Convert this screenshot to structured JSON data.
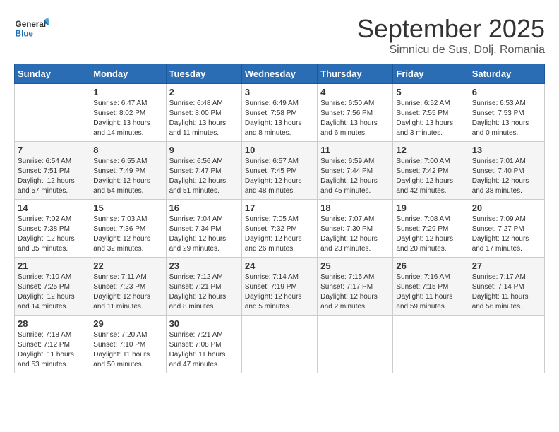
{
  "logo": {
    "general": "General",
    "blue": "Blue"
  },
  "header": {
    "month_title": "September 2025",
    "subtitle": "Simnicu de Sus, Dolj, Romania"
  },
  "days_of_week": [
    "Sunday",
    "Monday",
    "Tuesday",
    "Wednesday",
    "Thursday",
    "Friday",
    "Saturday"
  ],
  "weeks": [
    [
      {
        "day": "",
        "info": ""
      },
      {
        "day": "1",
        "info": "Sunrise: 6:47 AM\nSunset: 8:02 PM\nDaylight: 13 hours and 14 minutes."
      },
      {
        "day": "2",
        "info": "Sunrise: 6:48 AM\nSunset: 8:00 PM\nDaylight: 13 hours and 11 minutes."
      },
      {
        "day": "3",
        "info": "Sunrise: 6:49 AM\nSunset: 7:58 PM\nDaylight: 13 hours and 8 minutes."
      },
      {
        "day": "4",
        "info": "Sunrise: 6:50 AM\nSunset: 7:56 PM\nDaylight: 13 hours and 6 minutes."
      },
      {
        "day": "5",
        "info": "Sunrise: 6:52 AM\nSunset: 7:55 PM\nDaylight: 13 hours and 3 minutes."
      },
      {
        "day": "6",
        "info": "Sunrise: 6:53 AM\nSunset: 7:53 PM\nDaylight: 13 hours and 0 minutes."
      }
    ],
    [
      {
        "day": "7",
        "info": "Sunrise: 6:54 AM\nSunset: 7:51 PM\nDaylight: 12 hours and 57 minutes."
      },
      {
        "day": "8",
        "info": "Sunrise: 6:55 AM\nSunset: 7:49 PM\nDaylight: 12 hours and 54 minutes."
      },
      {
        "day": "9",
        "info": "Sunrise: 6:56 AM\nSunset: 7:47 PM\nDaylight: 12 hours and 51 minutes."
      },
      {
        "day": "10",
        "info": "Sunrise: 6:57 AM\nSunset: 7:45 PM\nDaylight: 12 hours and 48 minutes."
      },
      {
        "day": "11",
        "info": "Sunrise: 6:59 AM\nSunset: 7:44 PM\nDaylight: 12 hours and 45 minutes."
      },
      {
        "day": "12",
        "info": "Sunrise: 7:00 AM\nSunset: 7:42 PM\nDaylight: 12 hours and 42 minutes."
      },
      {
        "day": "13",
        "info": "Sunrise: 7:01 AM\nSunset: 7:40 PM\nDaylight: 12 hours and 38 minutes."
      }
    ],
    [
      {
        "day": "14",
        "info": "Sunrise: 7:02 AM\nSunset: 7:38 PM\nDaylight: 12 hours and 35 minutes."
      },
      {
        "day": "15",
        "info": "Sunrise: 7:03 AM\nSunset: 7:36 PM\nDaylight: 12 hours and 32 minutes."
      },
      {
        "day": "16",
        "info": "Sunrise: 7:04 AM\nSunset: 7:34 PM\nDaylight: 12 hours and 29 minutes."
      },
      {
        "day": "17",
        "info": "Sunrise: 7:05 AM\nSunset: 7:32 PM\nDaylight: 12 hours and 26 minutes."
      },
      {
        "day": "18",
        "info": "Sunrise: 7:07 AM\nSunset: 7:30 PM\nDaylight: 12 hours and 23 minutes."
      },
      {
        "day": "19",
        "info": "Sunrise: 7:08 AM\nSunset: 7:29 PM\nDaylight: 12 hours and 20 minutes."
      },
      {
        "day": "20",
        "info": "Sunrise: 7:09 AM\nSunset: 7:27 PM\nDaylight: 12 hours and 17 minutes."
      }
    ],
    [
      {
        "day": "21",
        "info": "Sunrise: 7:10 AM\nSunset: 7:25 PM\nDaylight: 12 hours and 14 minutes."
      },
      {
        "day": "22",
        "info": "Sunrise: 7:11 AM\nSunset: 7:23 PM\nDaylight: 12 hours and 11 minutes."
      },
      {
        "day": "23",
        "info": "Sunrise: 7:12 AM\nSunset: 7:21 PM\nDaylight: 12 hours and 8 minutes."
      },
      {
        "day": "24",
        "info": "Sunrise: 7:14 AM\nSunset: 7:19 PM\nDaylight: 12 hours and 5 minutes."
      },
      {
        "day": "25",
        "info": "Sunrise: 7:15 AM\nSunset: 7:17 PM\nDaylight: 12 hours and 2 minutes."
      },
      {
        "day": "26",
        "info": "Sunrise: 7:16 AM\nSunset: 7:15 PM\nDaylight: 11 hours and 59 minutes."
      },
      {
        "day": "27",
        "info": "Sunrise: 7:17 AM\nSunset: 7:14 PM\nDaylight: 11 hours and 56 minutes."
      }
    ],
    [
      {
        "day": "28",
        "info": "Sunrise: 7:18 AM\nSunset: 7:12 PM\nDaylight: 11 hours and 53 minutes."
      },
      {
        "day": "29",
        "info": "Sunrise: 7:20 AM\nSunset: 7:10 PM\nDaylight: 11 hours and 50 minutes."
      },
      {
        "day": "30",
        "info": "Sunrise: 7:21 AM\nSunset: 7:08 PM\nDaylight: 11 hours and 47 minutes."
      },
      {
        "day": "",
        "info": ""
      },
      {
        "day": "",
        "info": ""
      },
      {
        "day": "",
        "info": ""
      },
      {
        "day": "",
        "info": ""
      }
    ]
  ]
}
